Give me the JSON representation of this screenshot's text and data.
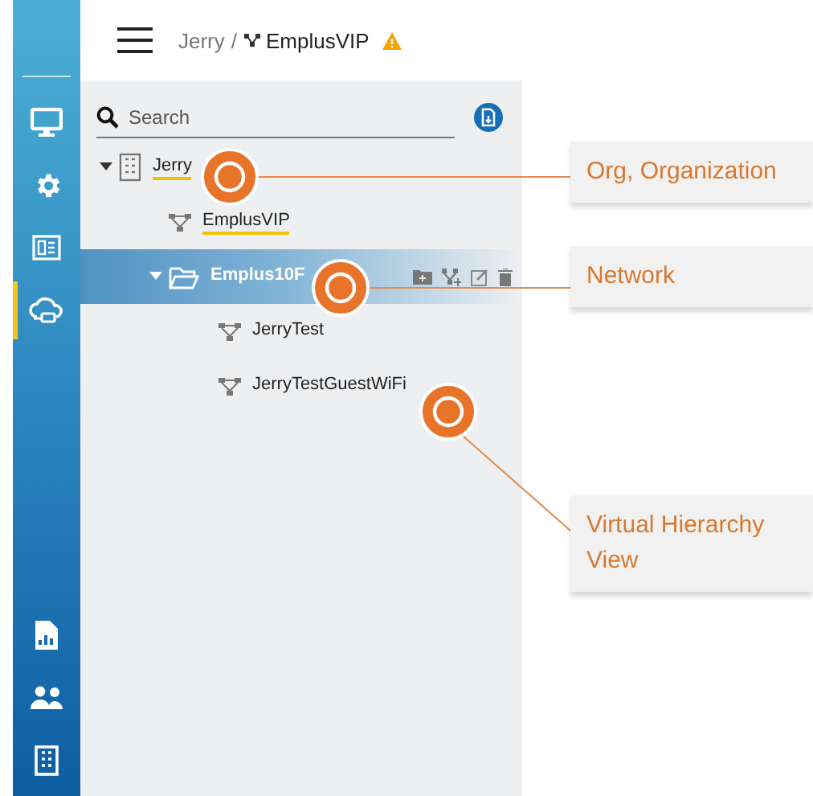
{
  "breadcrumb": {
    "org": "Jerry",
    "separator": "/",
    "network": "EmplusVIP"
  },
  "sidebar": {
    "items": [
      {
        "kind": "monitor",
        "selected": false
      },
      {
        "kind": "gear",
        "selected": false
      },
      {
        "kind": "panel",
        "selected": false
      },
      {
        "kind": "cloud",
        "selected": true
      },
      {
        "kind": "report",
        "selected": false
      },
      {
        "kind": "people",
        "selected": false
      },
      {
        "kind": "building",
        "selected": false
      }
    ]
  },
  "search": {
    "placeholder": "Search"
  },
  "tree": [
    {
      "label": "Jerry",
      "kind": "org",
      "expanded": true,
      "selected": false,
      "highlighted": true,
      "children": [
        {
          "label": "EmplusVIP",
          "kind": "network",
          "selected": false,
          "highlighted": true
        },
        {
          "label": "Emplus10F",
          "kind": "folder",
          "expanded": true,
          "selected": true,
          "highlighted": false,
          "children": [
            {
              "label": "JerryTest",
              "kind": "network",
              "selected": false,
              "highlighted": false
            },
            {
              "label": "JerryTestGuestWiFi",
              "kind": "network",
              "selected": false,
              "highlighted": false
            }
          ]
        }
      ]
    }
  ],
  "callouts": [
    {
      "label": "Org, Organization"
    },
    {
      "label": "Network"
    },
    {
      "label": "Virtual Hierarchy View"
    }
  ]
}
